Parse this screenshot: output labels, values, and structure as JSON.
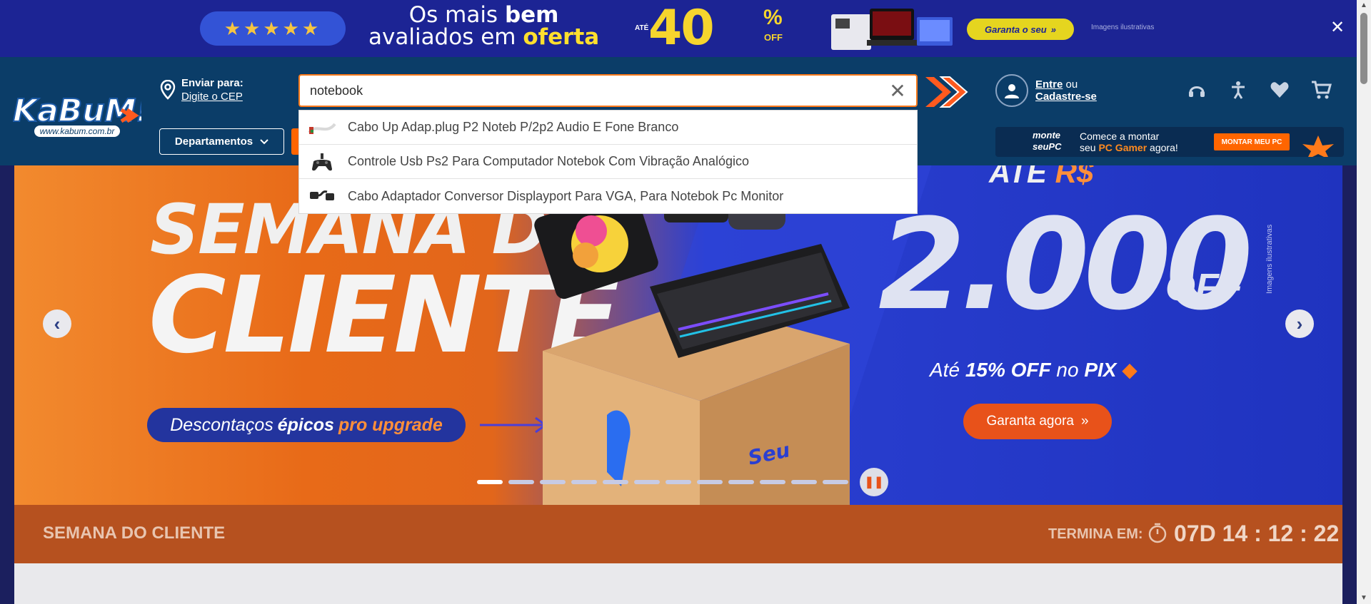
{
  "promo": {
    "rating_stars": "★★★★★",
    "headline_pre": "Os mais ",
    "headline_bold": "bem",
    "headline_line2": "avaliados em ",
    "headline_accent": "oferta",
    "ate": "ATÉ",
    "discount": "40",
    "pct": "%",
    "off": "OFF",
    "cta": "Garanta o seu",
    "note": "Imagens ilustrativas",
    "close_icon": "close-icon"
  },
  "header": {
    "logo_text": "KaBuM!",
    "logo_sub": "www.kabum.com.br",
    "ship_label": "Enviar para:",
    "ship_link": "Digite o CEP",
    "search_value": "notebook",
    "departments": "Departamentos",
    "account_login": "Entre",
    "account_or": " ou",
    "account_register": "Cadastre-se",
    "icons": [
      "support-icon",
      "accessibility-icon",
      "heart-icon",
      "cart-icon"
    ]
  },
  "mount": {
    "logo": "monte seuPC",
    "line1": "Comece a montar",
    "line2_pre": "seu ",
    "line2_accent": "PC Gamer",
    "line2_post": " agora!",
    "button": "MONTAR MEU PC"
  },
  "suggestions": [
    {
      "text": "Cabo Up Adap.plug P2 Noteb P/2p2 Audio E Fone Branco",
      "icon": "cable-icon"
    },
    {
      "text": "Controle Usb Ps2 Para Computador Notebok Com Vibração Analógico",
      "icon": "gamepad-icon"
    },
    {
      "text": "Cabo Adaptador Conversor Displayport Para VGA, Para Notebok Pc Monitor",
      "icon": "adapter-icon"
    }
  ],
  "hero": {
    "title1": "SEMANA DO",
    "title2": "CLIENTE",
    "desc_pre": "Descontaços",
    "desc_bold": "épicos",
    "desc_accent": "pro upgrade",
    "ate": "ATÉ ",
    "currency": "R$",
    "amount": "2.000",
    "off": "OFF",
    "pix_pre": "Até ",
    "pix_bold": "15% OFF",
    "pix_mid": " no ",
    "pix_word": "PIX",
    "cta": "Garanta agora",
    "note": "Imagens ilustrativas",
    "slide_count": 12,
    "active_slide": 1
  },
  "campaign": {
    "name": "SEMANA DO CLIENTE",
    "ends_label": "TERMINA EM:",
    "timer": "07D 14 : 12 : 22"
  },
  "colors": {
    "brand_blue": "#0b3d68",
    "accent_orange": "#ff6500",
    "promo_blue": "#1c2494"
  }
}
